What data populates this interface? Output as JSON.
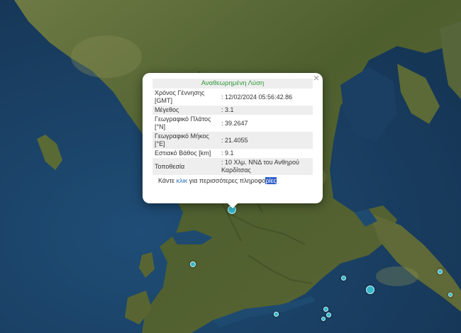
{
  "popup": {
    "title": "Αναθεωρημένη Λύση",
    "close_glyph": "×",
    "rows": [
      {
        "label": "Χρόνος Γέννησης [GMT]",
        "value": ": 12/02/2024 05:56:42.86"
      },
      {
        "label": "Μέγεθος",
        "value": ": 3.1"
      },
      {
        "label": "Γεωγραφικό Πλάτος [°N]",
        "value": ": 39.2647"
      },
      {
        "label": "Γεωγραφικό Μήκος [°E]",
        "value": ": 21.4055"
      },
      {
        "label": "Εστιακό Βάθος [km]",
        "value": ": 9.1"
      },
      {
        "label": "Τοποθεσία",
        "value": ": 10 Χλμ. ΝΝΔ του Ανθηρού Καρδίτσας"
      }
    ],
    "more_prefix": "Κάντε ",
    "more_link": "κλικ",
    "more_middle": " για περισσότερες πληροφο",
    "more_selected": "ρίες"
  },
  "colors": {
    "marker": "#34b7c9",
    "title": "#2e9a3b",
    "link": "#2a6fb7"
  }
}
